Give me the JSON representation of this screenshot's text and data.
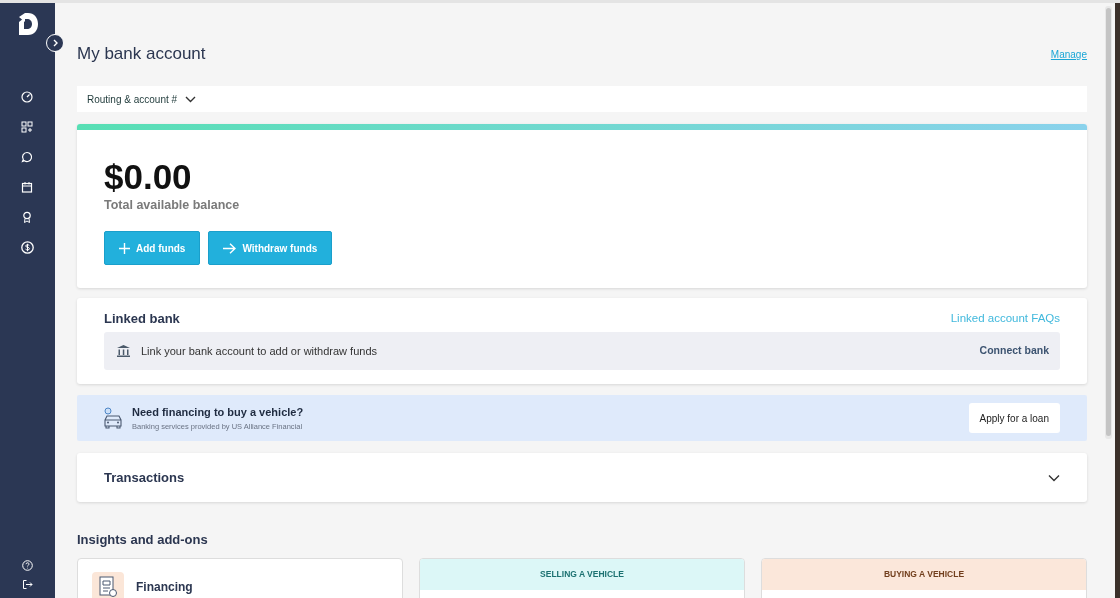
{
  "page": {
    "title": "My bank account",
    "manage_link": "Manage"
  },
  "account_selector": {
    "label": "Routing & account #"
  },
  "balance": {
    "amount": "$0.00",
    "caption": "Total available balance",
    "buttons": [
      {
        "label": "Add funds",
        "kind": "add"
      },
      {
        "label": "Withdraw funds",
        "kind": "withdraw"
      }
    ]
  },
  "linked_bank": {
    "title": "Linked bank",
    "faq_link": "Linked account FAQs",
    "message": "Link your bank account to add or withdraw funds",
    "action": "Connect bank"
  },
  "financing_banner": {
    "title": "Need financing to buy a vehicle?",
    "subtitle": "Banking services provided by US Alliance Financial",
    "action": "Apply for a loan"
  },
  "transactions": {
    "title": "Transactions",
    "expanded": false
  },
  "insights": {
    "title": "Insights and add-ons",
    "cards": [
      {
        "kind": "icon",
        "title": "Financing"
      },
      {
        "kind": "header",
        "title": "SELLING A VEHICLE",
        "color": "#dcf7f7"
      },
      {
        "kind": "header",
        "title": "BUYING A VEHICLE",
        "color": "#fbe7da"
      }
    ]
  }
}
